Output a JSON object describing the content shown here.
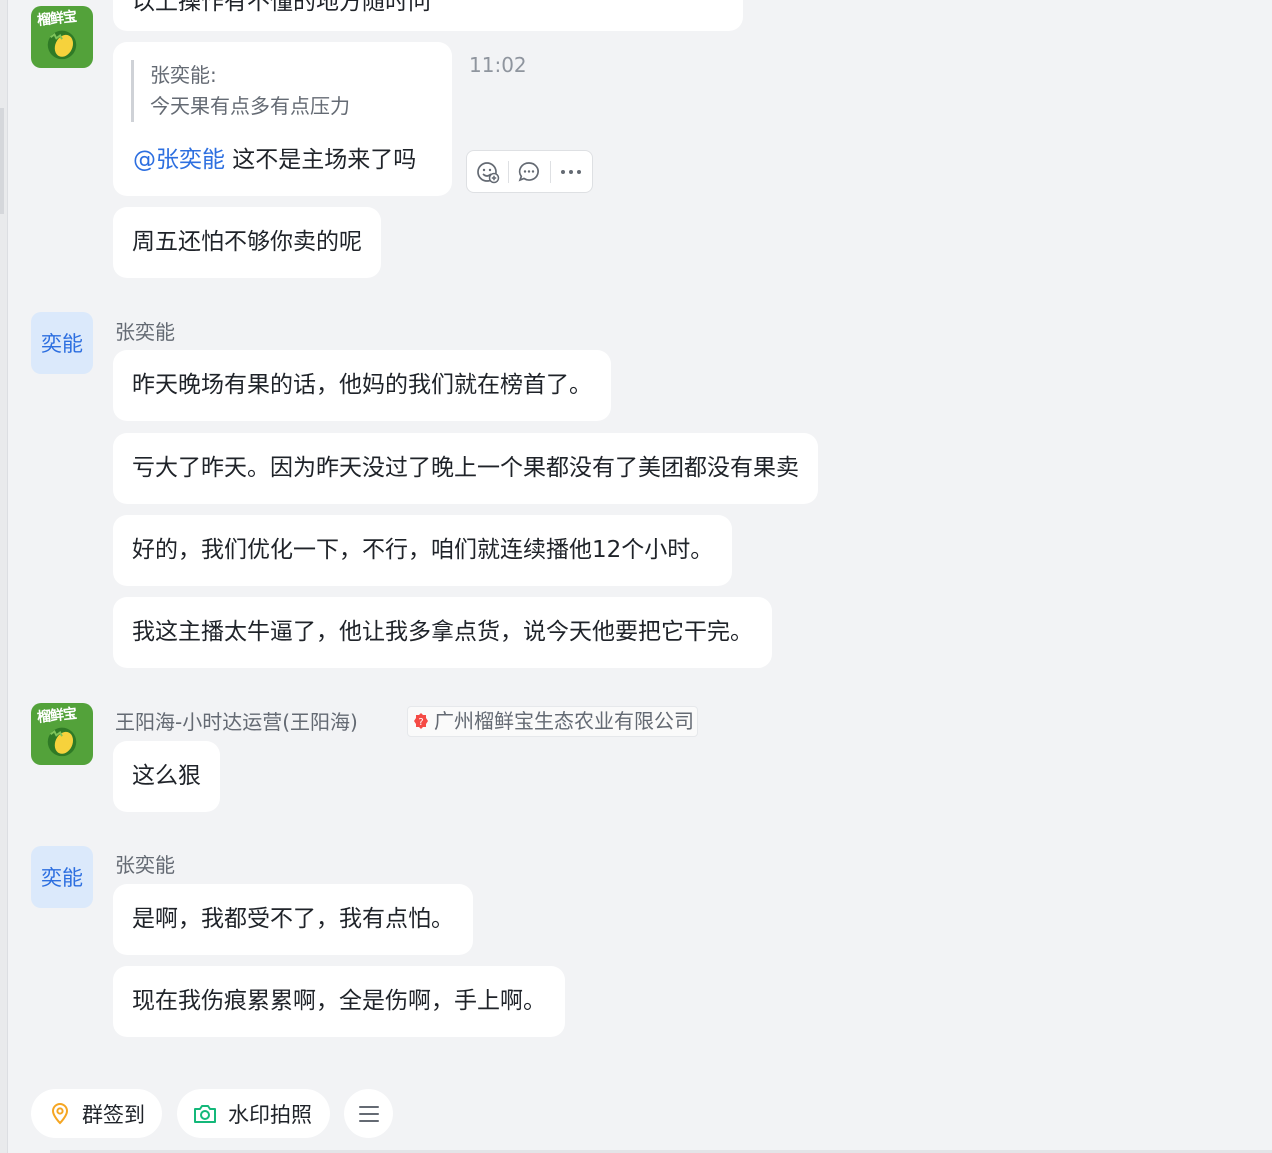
{
  "top_partial_message": "以上操作有不懂的地方随时问",
  "quote_message": {
    "quoted_sender": "张奕能:",
    "quoted_text": "今天果有点多有点压力",
    "mention": "@张奕能",
    "text": " 这不是主场来了吗",
    "time": "11:02"
  },
  "message_actions": [
    "add-reaction",
    "reply",
    "more"
  ],
  "standalone_message": "周五还怕不够你卖的呢",
  "group1": {
    "avatar_label": "奕能",
    "sender": "张奕能",
    "messages": [
      "昨天晚场有果的话，他妈的我们就在榜首了。",
      "亏大了昨天。因为昨天没过了晚上一个果都没有了美团都没有果卖",
      "好的，我们优化一下，不行，咱们就连续播他12个小时。",
      "我这主播太牛逼了，他让我多拿点货，说今天他要把它干完。"
    ]
  },
  "group2": {
    "avatar_label": "榴鲜宝",
    "sender": "王阳海-小时达运营(王阳海)",
    "company": "广州榴鲜宝生态农业有限公司",
    "messages": [
      "这么狠"
    ]
  },
  "group3": {
    "avatar_label": "奕能",
    "sender": "张奕能",
    "messages": [
      "是啊，我都受不了，我有点怕。",
      "现在我伤痕累累啊，全是伤啊，手上啊。"
    ]
  },
  "toolbar": {
    "checkin_label": "群签到",
    "watermark_label": "水印拍照"
  },
  "colors": {
    "background": "#f2f3f5",
    "bubble": "#ffffff",
    "mention": "#2d6fe0",
    "checkin_icon": "#f5a623",
    "camera_icon": "#14b87a",
    "company_badge": "#f54a45"
  }
}
